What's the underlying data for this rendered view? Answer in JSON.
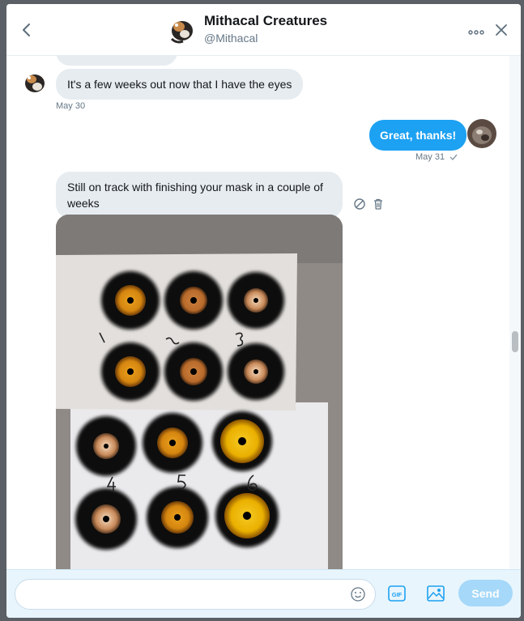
{
  "header": {
    "name": "Mithacal Creatures",
    "handle": "@Mithacal",
    "back_icon": "chevron-left-icon",
    "more_icon": "more-dots-icon",
    "close_icon": "close-icon"
  },
  "messages": [
    {
      "direction": "in",
      "text": "It's a few weeks out now that I have the eyes",
      "timestamp": "May 30"
    },
    {
      "direction": "out",
      "text": "Great, thanks!",
      "timestamp": "May 31",
      "status_icon": "check-icon"
    },
    {
      "direction": "in",
      "text": "Still on track with finishing your mask in a couple of weeks",
      "has_image": true,
      "actions": [
        "report-icon",
        "delete-icon"
      ]
    }
  ],
  "photo": {
    "numbers": [
      "1",
      "2",
      "3",
      "4",
      "5",
      "6"
    ]
  },
  "composer": {
    "placeholder": "",
    "emoji_icon": "emoji-icon",
    "gif_label": "GIF",
    "media_icon": "image-icon",
    "send_label": "Send"
  },
  "colors": {
    "accent": "#1da1f2",
    "send_disabled": "#a5d8f9",
    "bubble_in": "#e6ecf0",
    "composer_bg": "#e8f5fd"
  }
}
